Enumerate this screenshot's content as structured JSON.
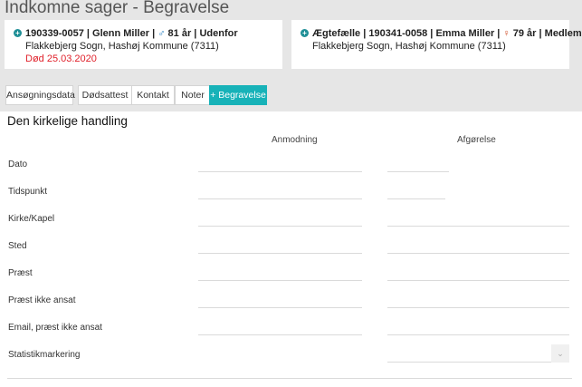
{
  "page": {
    "title": "Indkomne sager - Begravelse"
  },
  "cards": {
    "deceased": {
      "cpr": "190339-0057",
      "name": "Glenn Miller",
      "gender_icon": "male-icon",
      "age": "81 år",
      "status": "Udenfor",
      "location": "Flakkebjerg Sogn, Hashøj Kommune (7311)",
      "death": "Død 25.03.2020"
    },
    "spouse": {
      "relation": "Ægtefælle",
      "cpr": "190341-0058",
      "name": "Emma Miller",
      "gender_icon": "female-icon",
      "age": "79 år",
      "status": "Medlem",
      "location": "Flakkebjerg Sogn, Hashøj Kommune (7311)"
    }
  },
  "tabs": [
    {
      "label": "Ansøgningsdata"
    },
    {
      "label": "Dødsattest"
    },
    {
      "label": "Kontakt"
    },
    {
      "label": "Noter"
    },
    {
      "label": "+ Begravelse",
      "active": true
    }
  ],
  "form": {
    "section_title": "Den kirkelige handling",
    "col_request": "Anmodning",
    "col_decision": "Afgørelse",
    "fields": [
      {
        "label": "Dato"
      },
      {
        "label": "Tidspunkt"
      },
      {
        "label": "Kirke/Kapel"
      },
      {
        "label": "Sted"
      },
      {
        "label": "Præst"
      },
      {
        "label": "Præst ikke ansat"
      },
      {
        "label": "Email, præst ikke ansat"
      },
      {
        "label": "Statistikmarkering"
      }
    ]
  },
  "colors": {
    "accent": "#17b2b8",
    "died": "#e0202a",
    "male": "#1f7bbf",
    "female": "#d0502a"
  }
}
